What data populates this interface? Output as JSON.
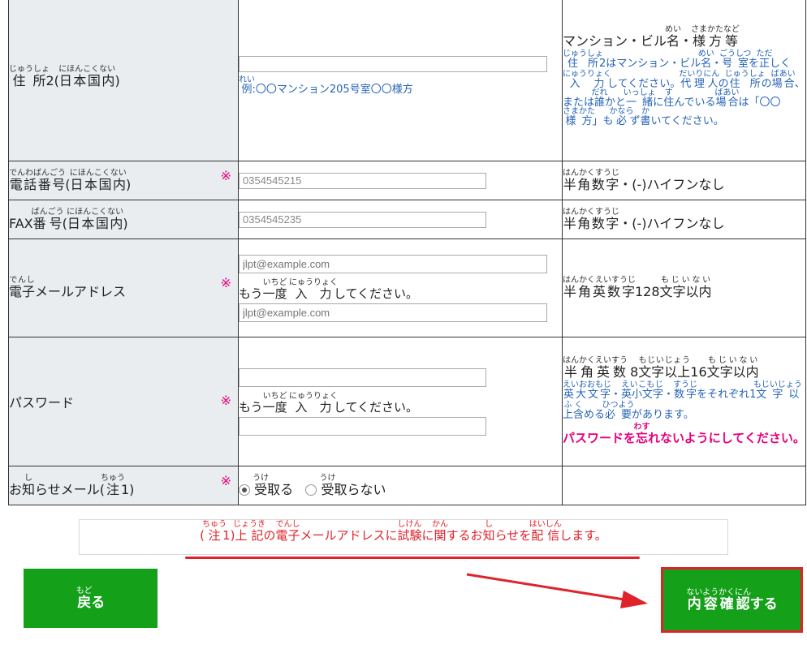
{
  "rows": {
    "address2": {
      "label": [
        {
          "t": "住所",
          "r": "じゅうしょ"
        },
        {
          "t": "2("
        },
        {
          "t": "日本国内",
          "r": "にほんこくない"
        },
        {
          "t": ")"
        }
      ],
      "example": [
        {
          "t": "例",
          "r": "れい"
        },
        {
          "t": ":〇〇マンション205号室〇〇様方"
        }
      ],
      "note_main": [
        {
          "t": "マンション・ビル"
        },
        {
          "t": "名",
          "r": "めい"
        },
        {
          "t": "・"
        },
        {
          "t": "様方等",
          "r": "さまかたなど"
        }
      ],
      "note_blue": [
        {
          "t": "住所",
          "r": "じゅうしょ"
        },
        {
          "t": "2はマンション・ビル"
        },
        {
          "t": "名",
          "r": "めい"
        },
        {
          "t": "・"
        },
        {
          "t": "号室",
          "r": "ごうしつ"
        },
        {
          "t": "を"
        },
        {
          "t": "正",
          "r": "ただ"
        },
        {
          "t": "しく"
        },
        {
          "t": "入力",
          "r": "にゅうりょく"
        },
        {
          "t": "してください。"
        },
        {
          "t": "代理人",
          "r": "だいりにん"
        },
        {
          "t": "の"
        },
        {
          "t": "住所",
          "r": "じゅうしょ"
        },
        {
          "t": "の"
        },
        {
          "t": "場合",
          "r": "ばあい"
        },
        {
          "t": "、または"
        },
        {
          "t": "誰",
          "r": "だれ"
        },
        {
          "t": "か"
        },
        {
          "t": "と"
        },
        {
          "t": "一緒",
          "r": "いっしょ"
        },
        {
          "t": "に"
        },
        {
          "t": "住",
          "r": "す"
        },
        {
          "t": "んでいる"
        },
        {
          "t": "場合",
          "r": "ばあい"
        },
        {
          "t": "は「〇〇"
        },
        {
          "t": "様方",
          "r": "さまかた"
        },
        {
          "t": "」も"
        },
        {
          "t": "必",
          "r": "かなら"
        },
        {
          "t": "ず"
        },
        {
          "t": "書",
          "r": "か"
        },
        {
          "t": "いてください。"
        }
      ]
    },
    "phone": {
      "label": [
        {
          "t": "電話番号",
          "r": "でんわばんごう"
        },
        {
          "t": "("
        },
        {
          "t": "日本国内",
          "r": "にほんこくない"
        },
        {
          "t": ")"
        }
      ],
      "required": "※",
      "value": "0354545215",
      "note": [
        {
          "t": "半角数字",
          "r": "はんかくすうじ"
        },
        {
          "t": "・(-)ハイフンなし"
        }
      ]
    },
    "fax": {
      "label": [
        {
          "t": "FAX"
        },
        {
          "t": "番号",
          "r": "ばんごう"
        },
        {
          "t": "("
        },
        {
          "t": "日本国内",
          "r": "にほんこくない"
        },
        {
          "t": ")"
        }
      ],
      "value": "0354545235",
      "note": [
        {
          "t": "半角数字",
          "r": "はんかくすうじ"
        },
        {
          "t": "・(-)ハイフンなし"
        }
      ]
    },
    "email": {
      "label": [
        {
          "t": "電子",
          "r": "でんし"
        },
        {
          "t": "メールアドレス"
        }
      ],
      "required": "※",
      "placeholder": "jlpt@example.com",
      "again": [
        {
          "t": "もう"
        },
        {
          "t": "一度",
          "r": "いちど"
        },
        {
          "t": " "
        },
        {
          "t": "入力",
          "r": "にゅうりょく"
        },
        {
          "t": "してください。"
        }
      ],
      "placeholder_confirm": "jlpt@example.com",
      "note": [
        {
          "t": "半角英数字",
          "r": "はんかくえいすうじ"
        },
        {
          "t": "128"
        },
        {
          "t": "文字以内",
          "r": "もじいない"
        }
      ]
    },
    "password": {
      "label": [
        {
          "t": "パスワード"
        }
      ],
      "required": "※",
      "again": [
        {
          "t": "もう"
        },
        {
          "t": "一度",
          "r": "いちど"
        },
        {
          "t": " "
        },
        {
          "t": "入力",
          "r": "にゅうりょく"
        },
        {
          "t": "してください。"
        }
      ],
      "note_main": [
        {
          "t": "半角英数",
          "r": "はんかくえいすう"
        },
        {
          "t": " 8"
        },
        {
          "t": "文字以上",
          "r": "もじいじょう"
        },
        {
          "t": "16"
        },
        {
          "t": "文字以内",
          "r": "もじいない"
        }
      ],
      "note_blue": [
        {
          "t": "英大文字",
          "r": "えいおおもじ"
        },
        {
          "t": "・"
        },
        {
          "t": "英小文字",
          "r": "えいこもじ"
        },
        {
          "t": "・"
        },
        {
          "t": "数字",
          "r": "すうじ"
        },
        {
          "t": "をそれぞれ1"
        },
        {
          "t": "文字以上含",
          "r": "もじいじょうふく"
        },
        {
          "t": "める"
        },
        {
          "t": "必要",
          "r": "ひつよう"
        },
        {
          "t": "があります。"
        }
      ],
      "note_pink": [
        {
          "t": "パスワードを"
        },
        {
          "t": "忘",
          "r": "わす"
        },
        {
          "t": "れないようにしてください。"
        }
      ]
    },
    "notice": {
      "label": [
        {
          "t": "お"
        },
        {
          "t": "知",
          "r": "し"
        },
        {
          "t": "らせメール("
        },
        {
          "t": "注",
          "r": "ちゅう"
        },
        {
          "t": "1)"
        }
      ],
      "required": "※",
      "option_receive": [
        {
          "t": "受",
          "r": "うけ"
        },
        {
          "t": "取る"
        }
      ],
      "option_decline": [
        {
          "t": "受",
          "r": "うけ"
        },
        {
          "t": "取らない"
        }
      ],
      "selected": "receive"
    }
  },
  "footnote": [
    {
      "t": "("
    },
    {
      "t": "注",
      "r": "ちゅう"
    },
    {
      "t": "1)"
    },
    {
      "t": "上記",
      "r": "じょうき"
    },
    {
      "t": "の"
    },
    {
      "t": "電子",
      "r": "でんし"
    },
    {
      "t": "メールアドレスに"
    },
    {
      "t": "試験",
      "r": "しけん"
    },
    {
      "t": "に"
    },
    {
      "t": "関",
      "r": "かん"
    },
    {
      "t": "するお"
    },
    {
      "t": "知",
      "r": "し"
    },
    {
      "t": "らせを"
    },
    {
      "t": "配信",
      "r": "はいしん"
    },
    {
      "t": "します。"
    }
  ],
  "buttons": {
    "back": [
      {
        "t": "戻",
        "r": "もど"
      },
      {
        "t": "る"
      }
    ],
    "confirm": [
      {
        "t": "内容確認",
        "r": "ないようかくにん"
      },
      {
        "t": "する"
      }
    ]
  },
  "colors": {
    "button_green": "#15a01a",
    "required_mark": "#e4007f",
    "annotation_red": "#e0232b",
    "info_blue": "#2563b6"
  },
  "icons": {
    "arrow": "red-arrow-icon"
  }
}
